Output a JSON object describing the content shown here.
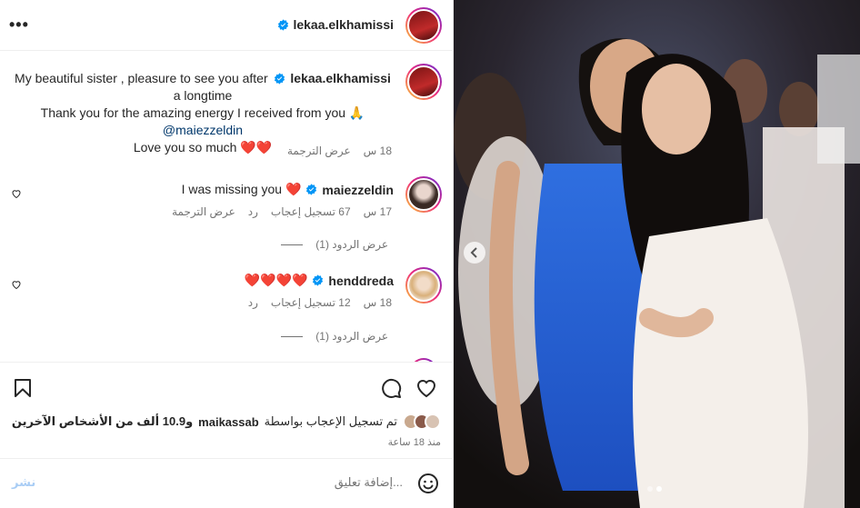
{
  "post": {
    "author": "lekaa.elkhamissi",
    "more_icon": "more-options-icon"
  },
  "caption": {
    "author": "lekaa.elkhamissi",
    "line1": "My beautiful sister , pleasure to see you after",
    "line2": "a longtime",
    "line3": "Thank you for the amazing energy I received from you 🙏",
    "line4_mention": "@maiezzeldin",
    "line5": "Love you so much ❤️❤️",
    "time": "18 س",
    "translate": "عرض الترجمة"
  },
  "comments": [
    {
      "user": "maiezzeldin",
      "text": "I was missing you ❤️",
      "time": "17 س",
      "likes": "67 تسجيل إعجاب",
      "reply": "رد",
      "translate": "عرض الترجمة",
      "view_replies": "عرض الردود (1)"
    },
    {
      "user": "henddreda",
      "text": "❤️❤️❤️❤️",
      "time": "18 س",
      "likes": "12 تسجيل إعجاب",
      "reply": "رد",
      "view_replies": "عرض الردود (1)"
    }
  ],
  "likes": {
    "text_prefix": "تم تسجيل الإعجاب بواسطة",
    "user": "maikassab",
    "text_suffix": "و10.9 ألف من الأشخاص الآخرين"
  },
  "time_ago": "منذ 18 ساعة",
  "add_comment": {
    "placeholder": "إضافة تعليق...",
    "post": "نشر"
  },
  "colors": {
    "accent_blue": "#0095f6",
    "heart_red": "#ed4956",
    "verified_blue": "#0095f6"
  }
}
